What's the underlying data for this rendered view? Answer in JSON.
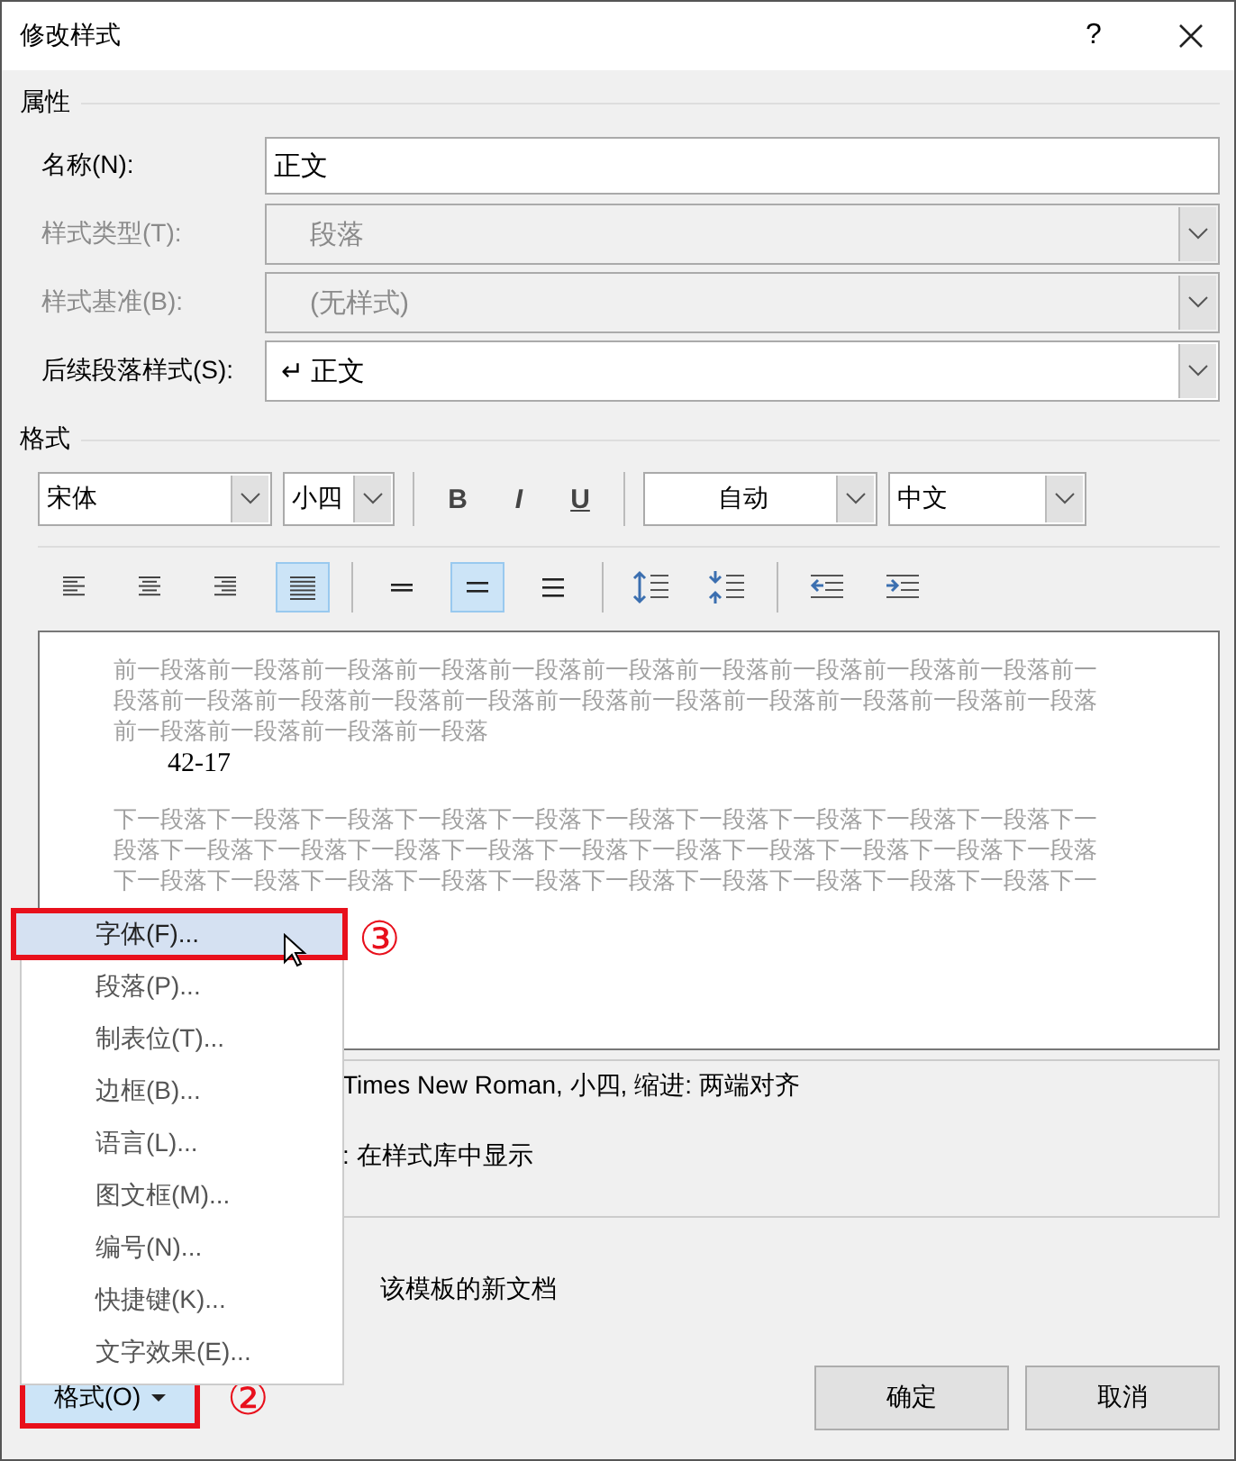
{
  "window": {
    "title": "修改样式",
    "help": "?"
  },
  "properties": {
    "heading": "属性",
    "fields": [
      {
        "label": "名称(N):",
        "kind": "text",
        "value": "正文",
        "disabled": false
      },
      {
        "label": "样式类型(T):",
        "kind": "select",
        "value": "段落",
        "disabled": true
      },
      {
        "label": "样式基准(B):",
        "kind": "select",
        "value": "(无样式)",
        "disabled": true
      },
      {
        "label": "后续段落样式(S):",
        "kind": "select",
        "value": "↵ 正文",
        "disabled": false
      }
    ]
  },
  "format": {
    "heading": "格式",
    "font": "宋体",
    "size": "小四",
    "styles": [
      {
        "kind": "bold",
        "label": "B",
        "selected": false
      },
      {
        "kind": "italic",
        "label": "I",
        "selected": false
      },
      {
        "kind": "underline",
        "label": "U",
        "selected": false
      }
    ],
    "font_color": "自动",
    "language": "中文",
    "paragraph_tools": [
      {
        "kind": "align-left",
        "selected": false
      },
      {
        "kind": "align-center",
        "selected": false
      },
      {
        "kind": "align-right",
        "selected": false
      },
      {
        "kind": "justify",
        "selected": true
      },
      {
        "kind": "single",
        "selected": false
      },
      {
        "kind": "one-half",
        "selected": true
      },
      {
        "kind": "double",
        "selected": false
      },
      {
        "kind": "space-increase",
        "selected": false
      },
      {
        "kind": "space-decrease",
        "selected": false
      },
      {
        "kind": "indent-decrease",
        "selected": false
      },
      {
        "kind": "indent-increase",
        "selected": false
      }
    ]
  },
  "preview": {
    "before_lines": [
      "前一段落前一段落前一段落前一段落前一段落前一段落前一段落前一段落前一段落前一段落前一",
      "段落前一段落前一段落前一段落前一段落前一段落前一段落前一段落前一段落前一段落前一段落",
      "前一段落前一段落前一段落前一段落"
    ],
    "sample": "42-17",
    "after_lines": [
      "下一段落下一段落下一段落下一段落下一段落下一段落下一段落下一段落下一段落下一段落下一",
      "段落下一段落下一段落下一段落下一段落下一段落下一段落下一段落下一段落下一段落下一段落",
      "下一段落下一段落下一段落下一段落下一段落下一段落下一段落下一段落下一段落下一段落下一"
    ]
  },
  "description": [
    "Times New Roman, 小四, 缩进: 两端对齐",
    ": 在样式库中显示"
  ],
  "option_text": "该模板的新文档",
  "menu": [
    {
      "label": "字体(F)...",
      "selected": true
    },
    {
      "label": "段落(P)...",
      "selected": false
    },
    {
      "label": "制表位(T)...",
      "selected": false
    },
    {
      "label": "边框(B)...",
      "selected": false
    },
    {
      "label": "语言(L)...",
      "selected": false
    },
    {
      "label": "图文框(M)...",
      "selected": false
    },
    {
      "label": "编号(N)...",
      "selected": false
    },
    {
      "label": "快捷键(K)...",
      "selected": false
    },
    {
      "label": "文字效果(E)...",
      "selected": false
    }
  ],
  "format_button": {
    "label": "格式(O)",
    "selected": true
  },
  "callouts": [
    {
      "label": "②"
    },
    {
      "label": "③"
    }
  ],
  "buttons": [
    {
      "label": "确定"
    },
    {
      "label": "取消"
    }
  ]
}
